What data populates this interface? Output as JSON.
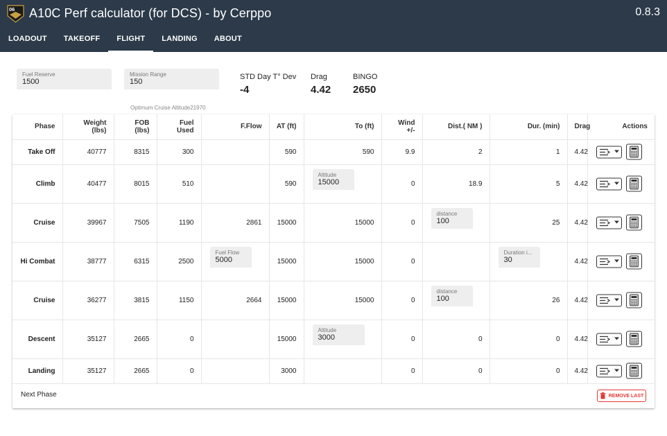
{
  "app": {
    "logo_text": "06",
    "title": "A10C Perf calculator (for DCS) - by Cerppo",
    "version": "0.8.3",
    "colors": {
      "appbar": "#2c3a4a",
      "accent": "#e53935"
    }
  },
  "tabs": [
    {
      "label": "LOADOUT"
    },
    {
      "label": "TAKEOFF"
    },
    {
      "label": "FLIGHT",
      "active": true
    },
    {
      "label": "LANDING"
    },
    {
      "label": "ABOUT"
    }
  ],
  "inputs": {
    "fuel_reserve": {
      "label": "Fuel Reserve",
      "value": "1500"
    },
    "mission_range": {
      "label": "Mission Range",
      "value": "150"
    }
  },
  "stats": {
    "std_day": {
      "label": "STD Day T° Dev",
      "value": "-4"
    },
    "drag": {
      "label": "Drag",
      "value": "4.42"
    },
    "bingo": {
      "label": "BINGO",
      "value": "2650"
    }
  },
  "hint": "Optimum Cruise Altitude21970",
  "table": {
    "headers": [
      "Phase",
      "Weight (lbs)",
      "FOB (lbs)",
      "Fuel Used",
      "F.Flow",
      "AT (ft)",
      "To (ft)",
      "Wind +/-",
      "Dist.( NM )",
      "Dur. (min)",
      "Drag",
      "Actions"
    ],
    "rows": [
      {
        "phase": "Take Off",
        "weight": "40777",
        "fob": "8315",
        "fuel_used": "300",
        "fflow": "",
        "at": "590",
        "to": "590",
        "wind": "9.9",
        "dist": "2",
        "dur": "1",
        "drag": "4.42"
      },
      {
        "phase": "Climb",
        "weight": "40477",
        "fob": "8015",
        "fuel_used": "510",
        "fflow": "",
        "at": "590",
        "to_field": {
          "label": "Altitude",
          "value": "15000"
        },
        "wind": "0",
        "dist": "18.9",
        "dur": "5",
        "drag": "4.42"
      },
      {
        "phase": "Cruise",
        "weight": "39967",
        "fob": "7505",
        "fuel_used": "1190",
        "fflow": "2861",
        "at": "15000",
        "to": "15000",
        "wind": "0",
        "dist_field": {
          "label": "distance",
          "value": "100"
        },
        "dur": "25",
        "drag": "4.42"
      },
      {
        "phase": "Hi Combat",
        "weight": "38777",
        "fob": "6315",
        "fuel_used": "2500",
        "fflow_field": {
          "label": "Fuel Flow",
          "value": "5000"
        },
        "at": "15000",
        "to": "15000",
        "wind": "0",
        "dist": "",
        "dur_field": {
          "label": "Duration i...",
          "value": "30"
        },
        "drag": "4.42"
      },
      {
        "phase": "Cruise",
        "weight": "36277",
        "fob": "3815",
        "fuel_used": "1150",
        "fflow": "2664",
        "at": "15000",
        "to": "15000",
        "wind": "0",
        "dist_field": {
          "label": "distance",
          "value": "100"
        },
        "dur": "26",
        "drag": "4.42"
      },
      {
        "phase": "Descent",
        "weight": "35127",
        "fob": "2665",
        "fuel_used": "0",
        "fflow": "",
        "at": "15000",
        "to_field": {
          "label": "Altitude",
          "value": "3000"
        },
        "wind": "0",
        "dist": "0",
        "dur": "0",
        "drag": "4.42"
      },
      {
        "phase": "Landing",
        "weight": "35127",
        "fob": "2665",
        "fuel_used": "0",
        "fflow": "",
        "at": "3000",
        "to": "",
        "wind": "0",
        "dist": "0",
        "dur": "0",
        "drag": "4.42"
      }
    ]
  },
  "footer": {
    "next_phase": "Next Phase",
    "remove_last": "REMOVE LAST"
  },
  "icons": {
    "select": "phase-options-icon",
    "calc": "calculator-icon",
    "trash": "trash-icon"
  }
}
